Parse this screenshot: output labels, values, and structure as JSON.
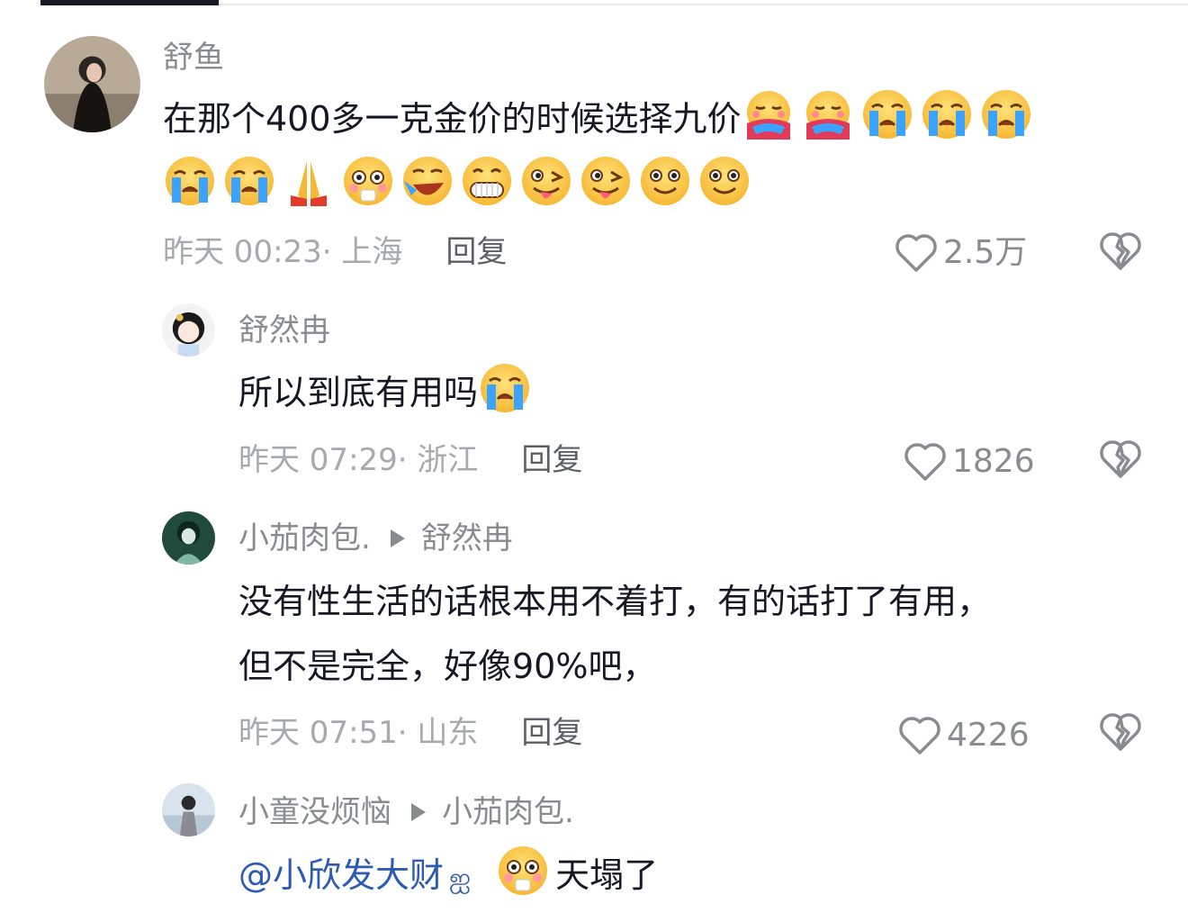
{
  "comments": [
    {
      "username": "舒鱼",
      "text_main": "在那个400多一克金价的时候选择九价",
      "time": "昨天 00:23",
      "location": "上海",
      "reply_label": "回复",
      "likes": "2.5万",
      "emojis_line1": [
        "hug-emoji",
        "hug-emoji",
        "crying-emoji",
        "crying-emoji",
        "crying-emoji"
      ],
      "emojis_line2": [
        "crying-emoji",
        "crying-emoji",
        "pray-emoji",
        "flushed-emoji",
        "rofl-emoji",
        "grin-emoji",
        "wink-tongue-emoji",
        "wink-tongue-emoji",
        "smile-emoji",
        "smile-emoji"
      ]
    },
    {
      "username": "舒然冉",
      "text_main": "所以到底有用吗",
      "time": "昨天 07:29",
      "location": "浙江",
      "reply_label": "回复",
      "likes": "1826"
    },
    {
      "username": "小茄肉包.",
      "reply_to": "舒然冉",
      "text_line1": "没有性生活的话根本用不着打，有的话打了有用，",
      "text_line2": "但不是完全，好像90%吧，",
      "time": "昨天 07:51",
      "location": "山东",
      "reply_label": "回复",
      "likes": "4226"
    },
    {
      "username": "小童没烦恼",
      "reply_to": "小茄肉包.",
      "mention": "@小欣发大财",
      "text_main": "天塌了"
    }
  ],
  "colors": {
    "text": "#161823",
    "secondary": "#8a8b91",
    "mention": "#2d5bb3"
  }
}
